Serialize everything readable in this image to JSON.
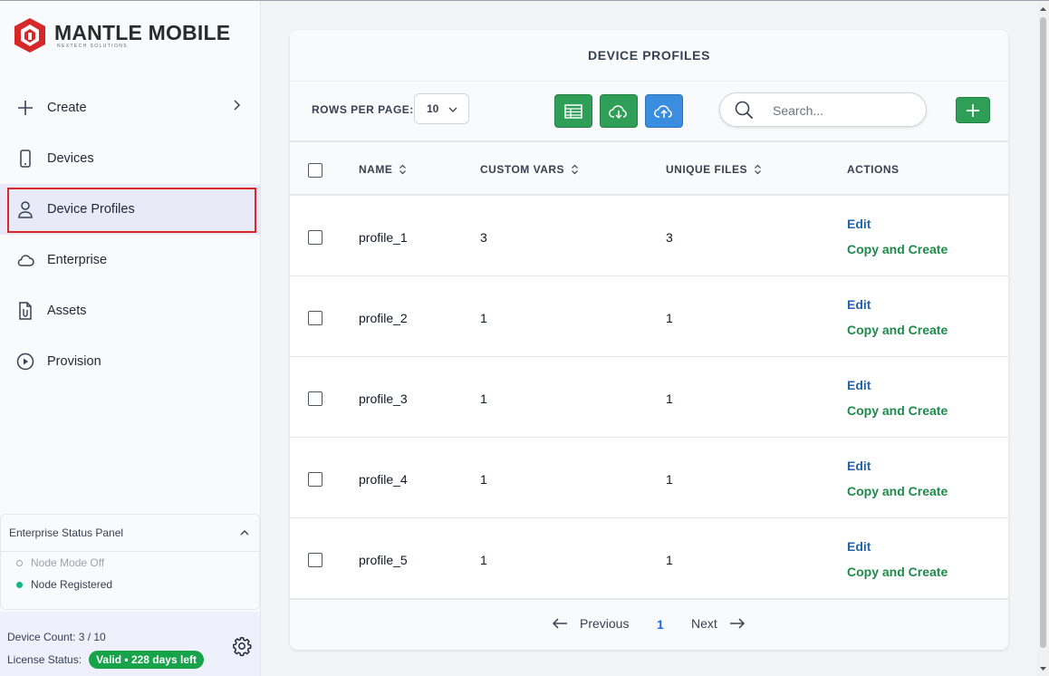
{
  "brand": {
    "name": "MANTLE MOBILE",
    "tagline": "NEXTECH SOLUTIONS"
  },
  "nav": [
    {
      "label": "Create",
      "icon": "plus-icon"
    },
    {
      "label": "Devices",
      "icon": "phone-icon"
    },
    {
      "label": "Device Profiles",
      "icon": "user-icon",
      "active": true
    },
    {
      "label": "Enterprise",
      "icon": "cloud-icon"
    },
    {
      "label": "Assets",
      "icon": "file-clip-icon"
    },
    {
      "label": "Provision",
      "icon": "play-circle-icon"
    }
  ],
  "status_panel": {
    "title": "Enterprise Status Panel",
    "items": [
      {
        "label": "Node Mode Off",
        "state": "off"
      },
      {
        "label": "Node Registered",
        "state": "on"
      }
    ]
  },
  "footer": {
    "device_count": "Device Count: 3 / 10",
    "license_label": "License Status:",
    "license_badge": "Valid • 228 days left"
  },
  "page": {
    "title": "DEVICE PROFILES"
  },
  "toolbar": {
    "rows_per_page_label": "ROWS PER PAGE:",
    "rows_per_page_value": "10",
    "search_placeholder": "Search..."
  },
  "table": {
    "columns": [
      "NAME",
      "CUSTOM VARS",
      "UNIQUE FILES",
      "ACTIONS"
    ],
    "rows": [
      {
        "name": "profile_1",
        "custom_vars": "3",
        "unique_files": "3",
        "edit": "Edit",
        "copy": "Copy and Create"
      },
      {
        "name": "profile_2",
        "custom_vars": "1",
        "unique_files": "1",
        "edit": "Edit",
        "copy": "Copy and Create"
      },
      {
        "name": "profile_3",
        "custom_vars": "1",
        "unique_files": "1",
        "edit": "Edit",
        "copy": "Copy and Create"
      },
      {
        "name": "profile_4",
        "custom_vars": "1",
        "unique_files": "1",
        "edit": "Edit",
        "copy": "Copy and Create"
      },
      {
        "name": "profile_5",
        "custom_vars": "1",
        "unique_files": "1",
        "edit": "Edit",
        "copy": "Copy and Create"
      }
    ]
  },
  "pagination": {
    "previous": "Previous",
    "page": "1",
    "next": "Next"
  },
  "colors": {
    "brand_red": "#dc2626",
    "green": "#2f9e57",
    "blue": "#3b8ddf",
    "link_blue": "#2563a8",
    "link_green": "#1e8a4a"
  }
}
